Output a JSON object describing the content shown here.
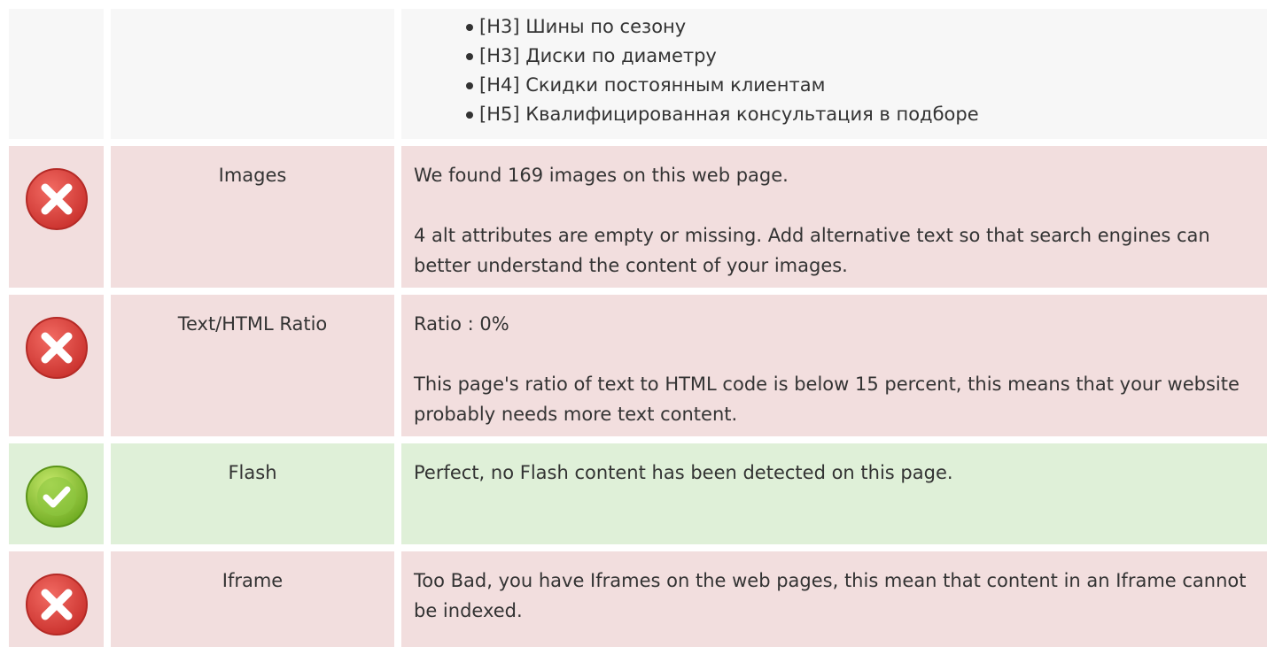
{
  "headings": {
    "items": [
      "[H3] Шины по сезону",
      "[H3] Диски по диаметру",
      "[H4] Скидки постоянным клиентам",
      "[H5] Квалифицированная консультация в подборе"
    ]
  },
  "rows": [
    {
      "status": "error",
      "icon": "error-x-icon",
      "label": "Images",
      "paragraphs": [
        "We found 169 images on this web page.",
        "4 alt attributes are empty or missing. Add alternative text so that search engines can better understand the content of your images."
      ]
    },
    {
      "status": "error",
      "icon": "error-x-icon",
      "label": "Text/HTML Ratio",
      "paragraphs": [
        "Ratio : 0%",
        "This page's ratio of text to HTML code is below 15 percent, this means that your website probably needs more text content."
      ]
    },
    {
      "status": "success",
      "icon": "success-check-icon",
      "label": "Flash",
      "paragraphs": [
        "Perfect, no Flash content has been detected on this page."
      ]
    },
    {
      "status": "error",
      "icon": "error-x-icon",
      "label": "Iframe",
      "paragraphs": [
        "Too Bad, you have Iframes on the web pages, this mean that content in an Iframe cannot be indexed."
      ]
    }
  ],
  "colors": {
    "error_bg": "#f2dede",
    "success_bg": "#dff0d8",
    "neutral_bg": "#f7f7f7",
    "error_icon": "#e0403a",
    "success_icon": "#8cc63f"
  }
}
